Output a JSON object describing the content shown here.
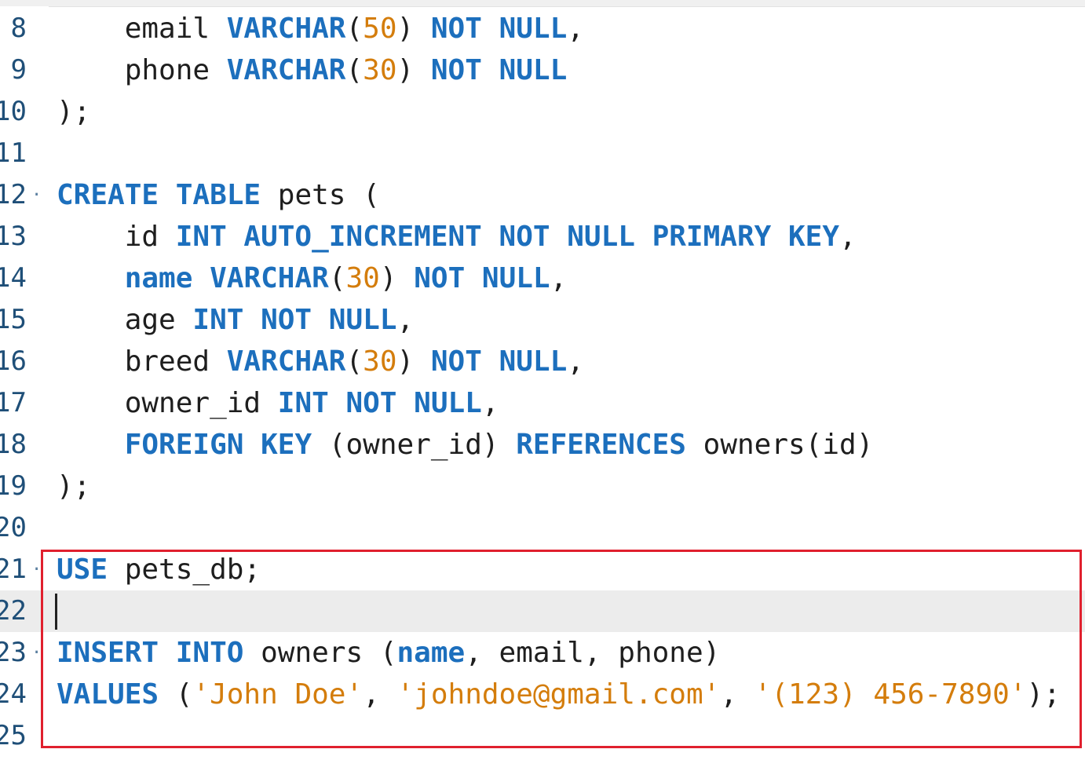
{
  "editor": {
    "lines": [
      {
        "num": "8",
        "tokens": [
          {
            "t": "    email ",
            "c": "id"
          },
          {
            "t": "VARCHAR",
            "c": "kw"
          },
          {
            "t": "(",
            "c": "pun"
          },
          {
            "t": "50",
            "c": "num"
          },
          {
            "t": ") ",
            "c": "pun"
          },
          {
            "t": "NOT NULL",
            "c": "kw"
          },
          {
            "t": ",",
            "c": "pun"
          }
        ]
      },
      {
        "num": "9",
        "tokens": [
          {
            "t": "    phone ",
            "c": "id"
          },
          {
            "t": "VARCHAR",
            "c": "kw"
          },
          {
            "t": "(",
            "c": "pun"
          },
          {
            "t": "30",
            "c": "num"
          },
          {
            "t": ") ",
            "c": "pun"
          },
          {
            "t": "NOT NULL",
            "c": "kw"
          }
        ]
      },
      {
        "num": "10",
        "tokens": [
          {
            "t": ");",
            "c": "pun"
          }
        ]
      },
      {
        "num": "11",
        "tokens": []
      },
      {
        "num": "12",
        "fold": "·",
        "tokens": [
          {
            "t": "CREATE TABLE",
            "c": "kw"
          },
          {
            "t": " pets (",
            "c": "id"
          }
        ]
      },
      {
        "num": "13",
        "tokens": [
          {
            "t": "    id ",
            "c": "id"
          },
          {
            "t": "INT AUTO_INCREMENT NOT NULL PRIMARY KEY",
            "c": "kw"
          },
          {
            "t": ",",
            "c": "pun"
          }
        ]
      },
      {
        "num": "14",
        "tokens": [
          {
            "t": "    ",
            "c": "id"
          },
          {
            "t": "name",
            "c": "kw"
          },
          {
            "t": " ",
            "c": "id"
          },
          {
            "t": "VARCHAR",
            "c": "kw"
          },
          {
            "t": "(",
            "c": "pun"
          },
          {
            "t": "30",
            "c": "num"
          },
          {
            "t": ") ",
            "c": "pun"
          },
          {
            "t": "NOT NULL",
            "c": "kw"
          },
          {
            "t": ",",
            "c": "pun"
          }
        ]
      },
      {
        "num": "15",
        "tokens": [
          {
            "t": "    age ",
            "c": "id"
          },
          {
            "t": "INT NOT NULL",
            "c": "kw"
          },
          {
            "t": ",",
            "c": "pun"
          }
        ]
      },
      {
        "num": "16",
        "tokens": [
          {
            "t": "    breed ",
            "c": "id"
          },
          {
            "t": "VARCHAR",
            "c": "kw"
          },
          {
            "t": "(",
            "c": "pun"
          },
          {
            "t": "30",
            "c": "num"
          },
          {
            "t": ") ",
            "c": "pun"
          },
          {
            "t": "NOT NULL",
            "c": "kw"
          },
          {
            "t": ",",
            "c": "pun"
          }
        ]
      },
      {
        "num": "17",
        "tokens": [
          {
            "t": "    owner_id ",
            "c": "id"
          },
          {
            "t": "INT NOT NULL",
            "c": "kw"
          },
          {
            "t": ",",
            "c": "pun"
          }
        ]
      },
      {
        "num": "18",
        "tokens": [
          {
            "t": "    ",
            "c": "id"
          },
          {
            "t": "FOREIGN KEY",
            "c": "kw"
          },
          {
            "t": " (owner_id) ",
            "c": "id"
          },
          {
            "t": "REFERENCES",
            "c": "kw"
          },
          {
            "t": " owners(id)",
            "c": "id"
          }
        ]
      },
      {
        "num": "19",
        "tokens": [
          {
            "t": ");",
            "c": "pun"
          }
        ]
      },
      {
        "num": "20",
        "tokens": []
      },
      {
        "num": "21",
        "fold": "·",
        "tokens": [
          {
            "t": "USE",
            "c": "kw"
          },
          {
            "t": " pets_db;",
            "c": "id"
          }
        ]
      },
      {
        "num": "22",
        "current": true,
        "tokens": []
      },
      {
        "num": "23",
        "fold": "·",
        "tokens": [
          {
            "t": "INSERT INTO",
            "c": "kw"
          },
          {
            "t": " owners (",
            "c": "id"
          },
          {
            "t": "name",
            "c": "kw"
          },
          {
            "t": ", email, phone)",
            "c": "id"
          }
        ]
      },
      {
        "num": "24",
        "tokens": [
          {
            "t": "VALUES",
            "c": "kw"
          },
          {
            "t": " (",
            "c": "pun"
          },
          {
            "t": "'John Doe'",
            "c": "str"
          },
          {
            "t": ", ",
            "c": "pun"
          },
          {
            "t": "'johndoe@gmail.com'",
            "c": "str"
          },
          {
            "t": ", ",
            "c": "pun"
          },
          {
            "t": "'(123) 456-7890'",
            "c": "str"
          },
          {
            "t": ");",
            "c": "pun"
          }
        ]
      },
      {
        "num": "25",
        "tokens": []
      }
    ]
  },
  "annotation": {
    "color": "#e0202e"
  }
}
